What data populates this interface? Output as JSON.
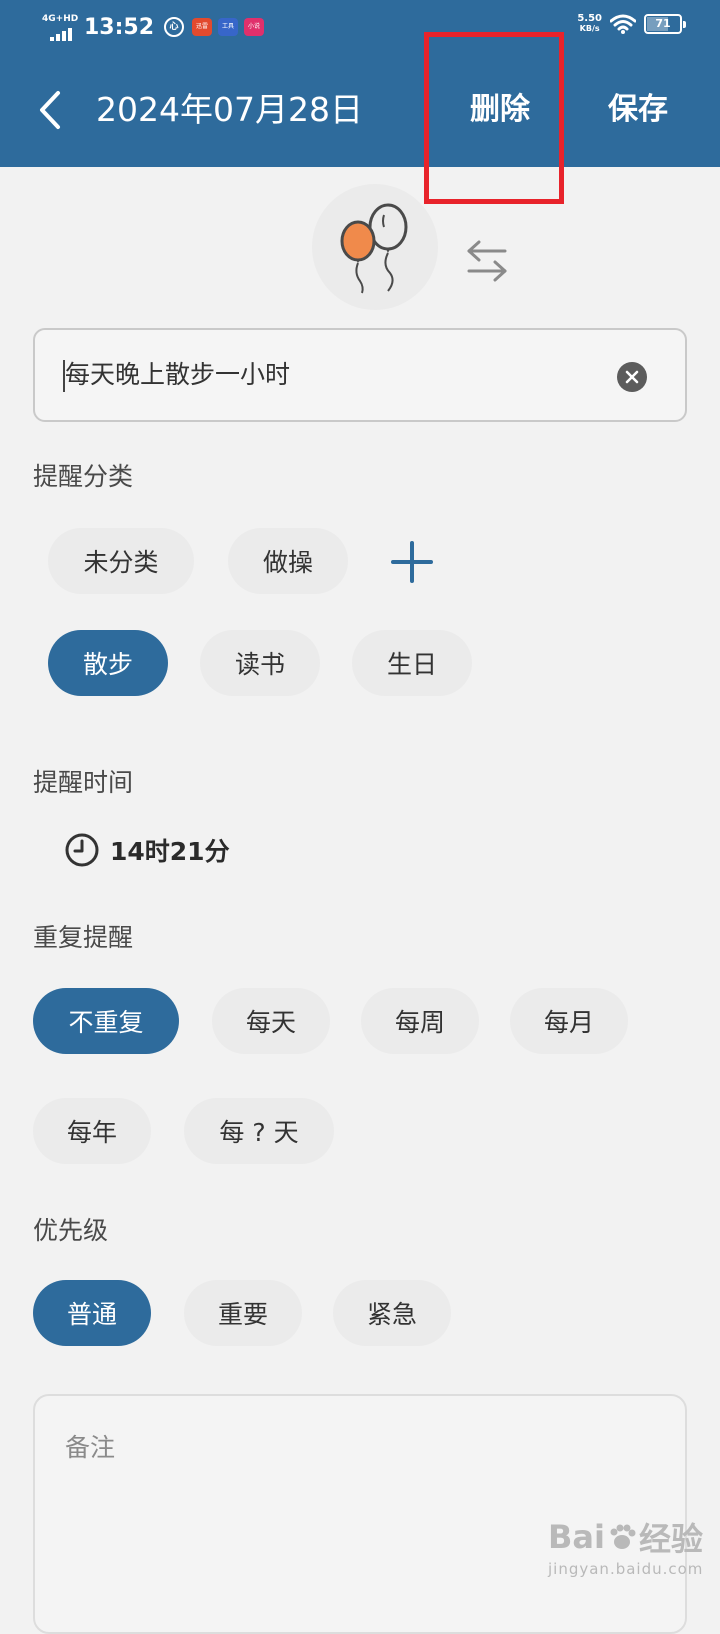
{
  "status_bar": {
    "network": "4G+HD",
    "time": "13:52",
    "circle_badge": "心",
    "app_icons": [
      {
        "name": "app-icon-red",
        "label": "迅雷",
        "color": "#e24a2e"
      },
      {
        "name": "app-icon-blue",
        "label": "工具",
        "color": "#3766c9"
      },
      {
        "name": "app-icon-pink",
        "label": "小说",
        "color": "#e0306c"
      }
    ],
    "speed_value": "5.50",
    "speed_unit": "KB/s",
    "battery": "71",
    "battery_level": 0.71
  },
  "header": {
    "title": "2024年07月28日",
    "delete_label": "删除",
    "save_label": "保存",
    "background_color": "#2e6b9c",
    "highlight_color": "#e8232b"
  },
  "icon": {
    "name": "balloons-icon",
    "swap_icon": "swap-arrows-icon"
  },
  "title_input": {
    "value": "每天晚上散步一小时"
  },
  "category": {
    "label": "提醒分类",
    "chips": [
      "未分类",
      "做操",
      "散步",
      "读书",
      "生日"
    ],
    "selected": "散步"
  },
  "time": {
    "label": "提醒时间",
    "value": "14时21分"
  },
  "repeat": {
    "label": "重复提醒",
    "chips": [
      "不重复",
      "每天",
      "每周",
      "每月",
      "每年",
      "每 ? 天"
    ],
    "selected": "不重复"
  },
  "priority": {
    "label": "优先级",
    "chips": [
      "普通",
      "重要",
      "紧急"
    ],
    "selected": "普通"
  },
  "notes": {
    "placeholder": "备注"
  },
  "watermark": {
    "brand": "Bai",
    "brand_suffix": "经验",
    "url": "jingyan.baidu.com"
  },
  "accent_color": "#2e6b9c"
}
